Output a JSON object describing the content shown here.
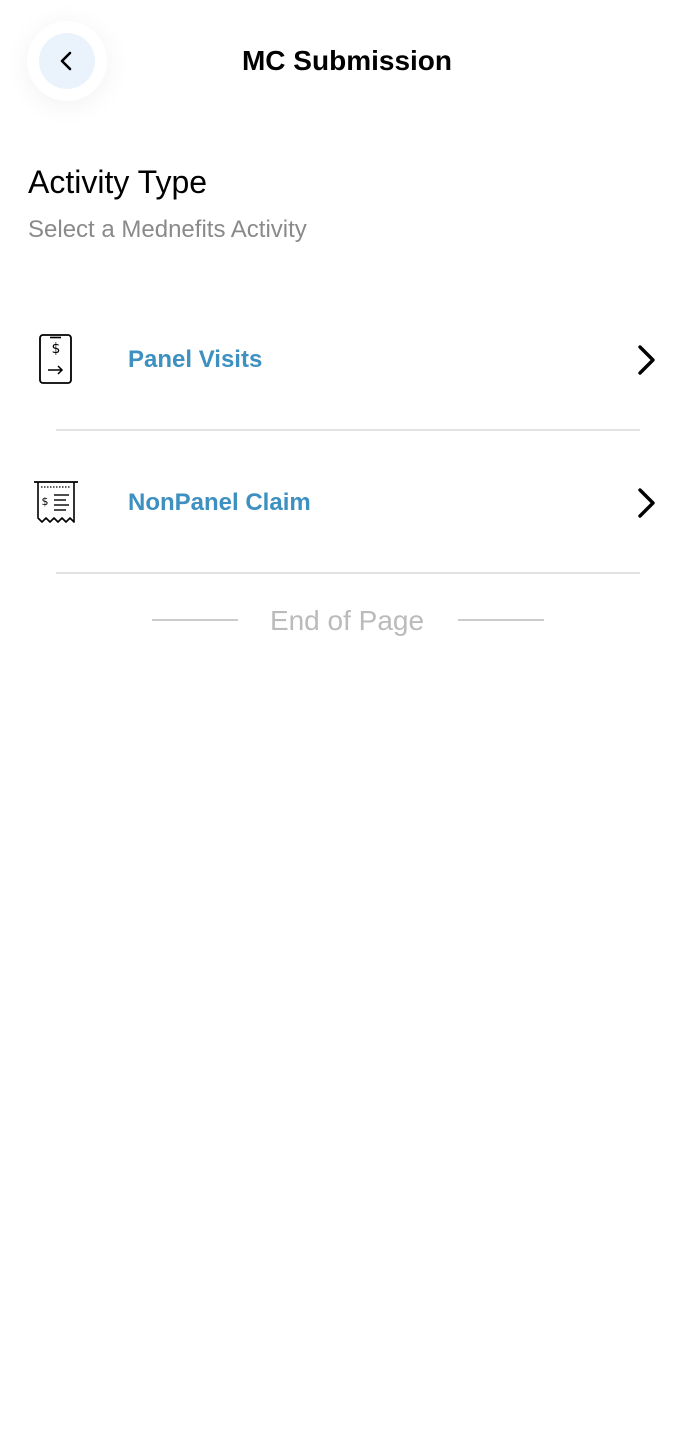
{
  "header": {
    "title": "MC Submission",
    "back_icon": "chevron-left-icon"
  },
  "section": {
    "title": "Activity Type",
    "subtitle": "Select a Mednefits Activity"
  },
  "activities": [
    {
      "label": "Panel Visits",
      "icon": "phone-payment-icon"
    },
    {
      "label": "NonPanel Claim",
      "icon": "receipt-icon"
    }
  ],
  "footer": {
    "end_text": "End of Page"
  },
  "colors": {
    "accent": "#3d90c0",
    "back_button_bg": "#eaf3fb",
    "muted_text": "#8a8a8a",
    "divider": "#e2e2e2"
  }
}
